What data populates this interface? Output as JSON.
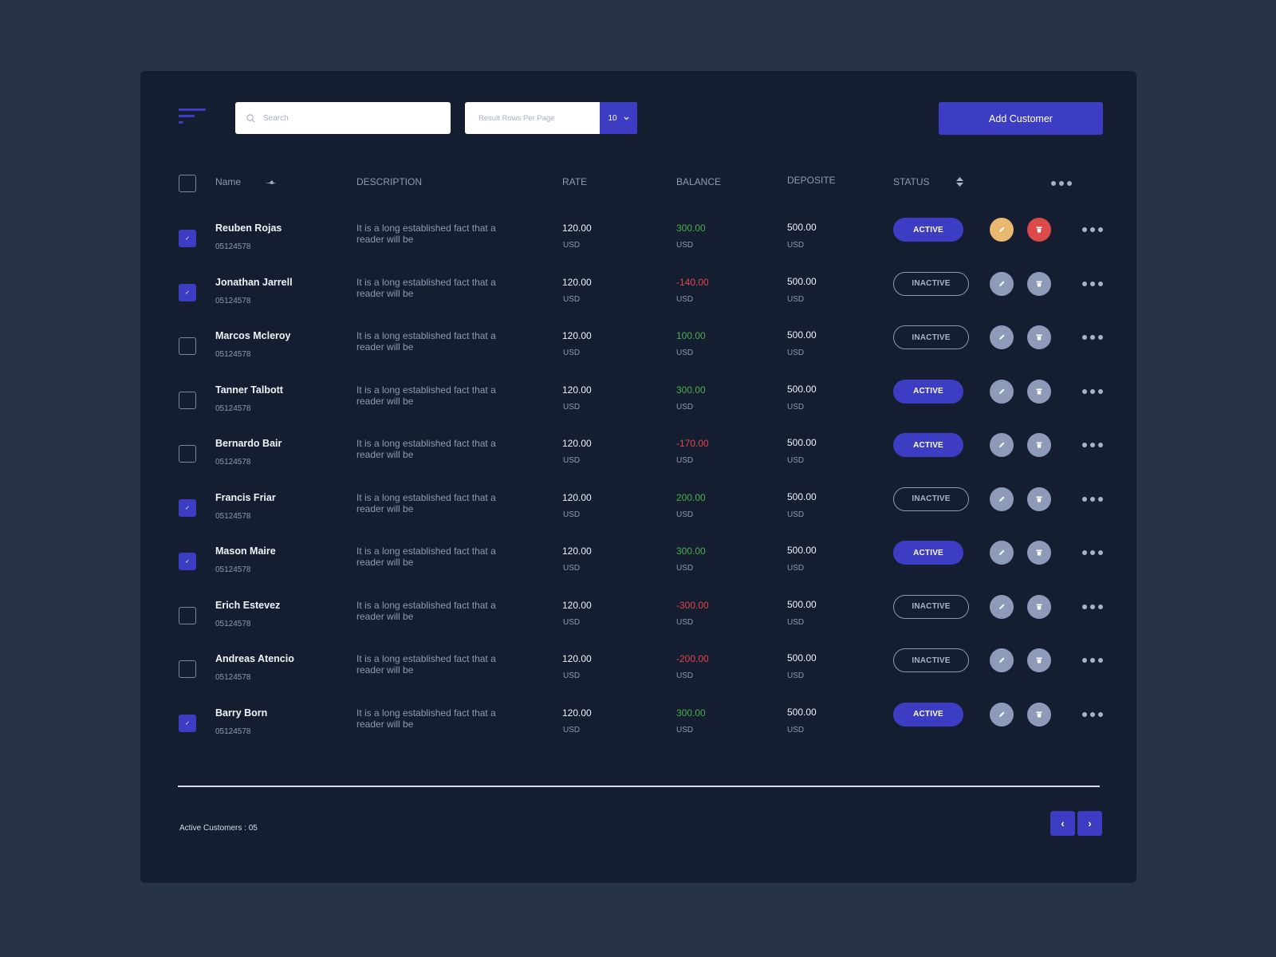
{
  "toolbar": {
    "menu_icon": "hamburger-left-align-icon",
    "search_placeholder": "Search",
    "rows_per_page_label": "Result Rows Per Page",
    "rows_per_page_value": "10",
    "add_customer_label": "Add Customer"
  },
  "colors": {
    "accent": "#3d3dc4",
    "positive": "#4caf50",
    "negative": "#e0454a",
    "edit_highlight": "#e8b96e",
    "delete_highlight": "#dd4a4a",
    "background": "#273348",
    "card": "#141e30"
  },
  "table": {
    "headers": {
      "name": "Name",
      "description": "DESCRIPTION",
      "rate": "RATE",
      "balance": "BALANCE",
      "deposite": "DEPOSITE",
      "status": "STATUS"
    },
    "rows": [
      {
        "checked": true,
        "name": "Reuben Rojas",
        "id": "05124578",
        "description": "It is a long established fact that a reader will be",
        "rate": "120.00",
        "rate_currency": "USD",
        "balance": "300.00",
        "balance_currency": "USD",
        "deposite": "500.00",
        "deposite_currency": "USD",
        "status": "ACTIVE",
        "highlighted_actions": true
      },
      {
        "checked": true,
        "name": "Jonathan Jarrell",
        "id": "05124578",
        "description": "It is a long established fact that a reader will be",
        "rate": "120.00",
        "rate_currency": "USD",
        "balance": "-140.00",
        "balance_currency": "USD",
        "deposite": "500.00",
        "deposite_currency": "USD",
        "status": "INACTIVE",
        "highlighted_actions": false
      },
      {
        "checked": false,
        "name": "Marcos Mcleroy",
        "id": "05124578",
        "description": "It is a long established fact that a reader will be",
        "rate": "120.00",
        "rate_currency": "USD",
        "balance": "100.00",
        "balance_currency": "USD",
        "deposite": "500.00",
        "deposite_currency": "USD",
        "status": "INACTIVE",
        "highlighted_actions": false
      },
      {
        "checked": false,
        "name": "Tanner Talbott",
        "id": "05124578",
        "description": "It is a long established fact that a reader will be",
        "rate": "120.00",
        "rate_currency": "USD",
        "balance": "300.00",
        "balance_currency": "USD",
        "deposite": "500.00",
        "deposite_currency": "USD",
        "status": "ACTIVE",
        "highlighted_actions": false
      },
      {
        "checked": false,
        "name": "Bernardo Bair",
        "id": "05124578",
        "description": "It is a long established fact that a reader will be",
        "rate": "120.00",
        "rate_currency": "USD",
        "balance": "-170.00",
        "balance_currency": "USD",
        "deposite": "500.00",
        "deposite_currency": "USD",
        "status": "ACTIVE",
        "highlighted_actions": false
      },
      {
        "checked": true,
        "name": "Francis Friar",
        "id": "05124578",
        "description": "It is a long established fact that a reader will be",
        "rate": "120.00",
        "rate_currency": "USD",
        "balance": "200.00",
        "balance_currency": "USD",
        "deposite": "500.00",
        "deposite_currency": "USD",
        "status": "INACTIVE",
        "highlighted_actions": false
      },
      {
        "checked": true,
        "name": "Mason Maire",
        "id": "05124578",
        "description": "It is a long established fact that a reader will be",
        "rate": "120.00",
        "rate_currency": "USD",
        "balance": "300.00",
        "balance_currency": "USD",
        "deposite": "500.00",
        "deposite_currency": "USD",
        "status": "ACTIVE",
        "highlighted_actions": false
      },
      {
        "checked": false,
        "name": "Erich Estevez",
        "id": "05124578",
        "description": "It is a long established fact that a reader will be",
        "rate": "120.00",
        "rate_currency": "USD",
        "balance": "-300.00",
        "balance_currency": "USD",
        "deposite": "500.00",
        "deposite_currency": "USD",
        "status": "INACTIVE",
        "highlighted_actions": false
      },
      {
        "checked": false,
        "name": "Andreas Atencio",
        "id": "05124578",
        "description": "It is a long established fact that a reader will be",
        "rate": "120.00",
        "rate_currency": "USD",
        "balance": "-200.00",
        "balance_currency": "USD",
        "deposite": "500.00",
        "deposite_currency": "USD",
        "status": "INACTIVE",
        "highlighted_actions": false
      },
      {
        "checked": true,
        "name": "Barry Born",
        "id": "05124578",
        "description": "It is a long established fact that a reader will be",
        "rate": "120.00",
        "rate_currency": "USD",
        "balance": "300.00",
        "balance_currency": "USD",
        "deposite": "500.00",
        "deposite_currency": "USD",
        "status": "ACTIVE",
        "highlighted_actions": false
      }
    ]
  },
  "footer": {
    "active_customers_text": "Active Customers : 05",
    "prev_label": "‹",
    "next_label": "›"
  }
}
